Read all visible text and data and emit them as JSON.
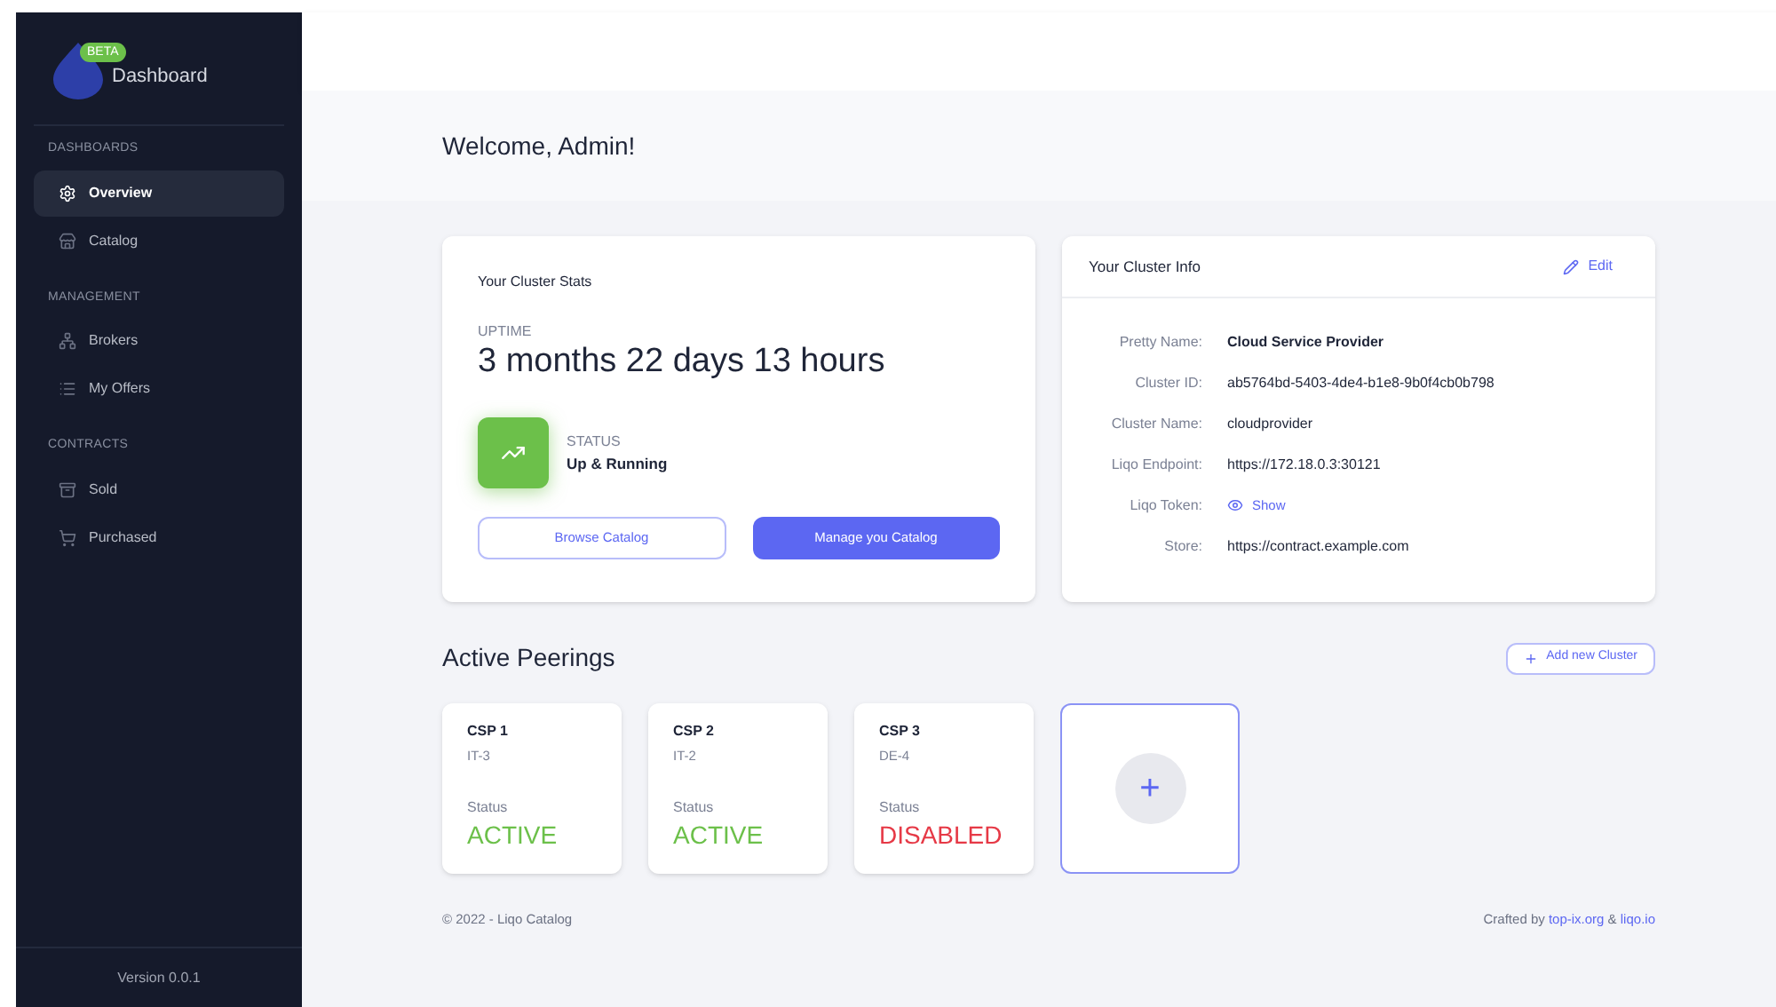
{
  "brand": {
    "badge": "BETA",
    "title": "Dashboard"
  },
  "sidebar": {
    "sections": [
      {
        "heading": "DASHBOARDS",
        "items": [
          {
            "label": "Overview",
            "kind": "gear",
            "selected": true
          },
          {
            "label": "Catalog",
            "kind": "store",
            "selected": false
          }
        ]
      },
      {
        "heading": "MANAGEMENT",
        "items": [
          {
            "label": "Brokers",
            "kind": "network",
            "selected": false
          },
          {
            "label": "My Offers",
            "kind": "list",
            "selected": false
          }
        ]
      },
      {
        "heading": "CONTRACTS",
        "items": [
          {
            "label": "Sold",
            "kind": "archive",
            "selected": false
          },
          {
            "label": "Purchased",
            "kind": "cart",
            "selected": false
          }
        ]
      }
    ],
    "version": "Version 0.0.1"
  },
  "welcome": "Welcome, Admin!",
  "stats": {
    "title": "Your Cluster Stats",
    "uptime_label": "UPTIME",
    "uptime": "3 months 22 days 13 hours",
    "status_label": "STATUS",
    "status": "Up & Running",
    "buttons": [
      "Browse Catalog",
      "Manage you Catalog"
    ]
  },
  "info": {
    "title": "Your Cluster Info",
    "edit": "Edit",
    "rows": [
      {
        "label": "Pretty Name:",
        "value": "Cloud Service Provider",
        "kind": "text"
      },
      {
        "label": "Cluster ID:",
        "value": "ab5764bd-5403-4de4-b1e8-9b0f4cb0b798",
        "kind": "text"
      },
      {
        "label": "Cluster Name:",
        "value": "cloudprovider",
        "kind": "text"
      },
      {
        "label": "Liqo Endpoint:",
        "value": "https://172.18.0.3:30121",
        "kind": "text"
      },
      {
        "label": "Liqo Token:",
        "value": "Show",
        "kind": "reveal"
      },
      {
        "label": "Store:",
        "value": "https://contract.example.com",
        "kind": "text"
      }
    ]
  },
  "peerings": {
    "title": "Active Peerings",
    "add_button": "Add new Cluster",
    "add_card": "+",
    "items": [
      {
        "name": "CSP 1",
        "region": "IT-3",
        "status_label": "Status",
        "status": "ACTIVE",
        "kind": "active"
      },
      {
        "name": "CSP 2",
        "region": "IT-2",
        "status_label": "Status",
        "status": "ACTIVE",
        "kind": "active"
      },
      {
        "name": "CSP 3",
        "region": "DE-4",
        "status_label": "Status",
        "status": "DISABLED",
        "kind": "disabled"
      }
    ]
  },
  "footer": {
    "copyright": "© 2022 - Liqo Catalog",
    "crafted_prefix": "Crafted by ",
    "links": [
      "top-ix.org",
      "liqo.io"
    ],
    "joiner": " & "
  }
}
